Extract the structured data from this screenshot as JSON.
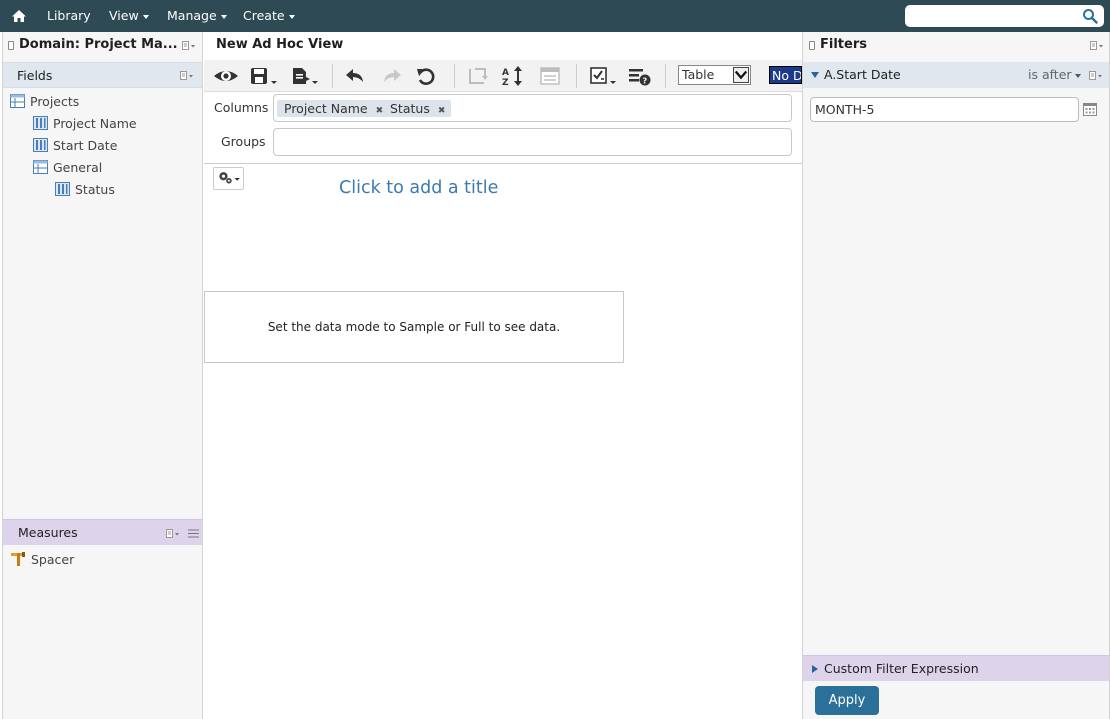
{
  "topbar": {
    "nav": [
      {
        "label": "Library",
        "has_caret": false
      },
      {
        "label": "View",
        "has_caret": true
      },
      {
        "label": "Manage",
        "has_caret": true
      },
      {
        "label": "Create",
        "has_caret": true
      }
    ],
    "search_value": ""
  },
  "left_panel": {
    "title": "Domain: Project Ma...",
    "fields_label": "Fields",
    "tree": [
      {
        "label": "Projects",
        "type": "table"
      },
      {
        "label": "Project Name",
        "type": "field"
      },
      {
        "label": "Start Date",
        "type": "field"
      },
      {
        "label": "General",
        "type": "table"
      },
      {
        "label": "Status",
        "type": "field"
      }
    ],
    "measures_label": "Measures",
    "measures": [
      {
        "label": "Spacer"
      }
    ]
  },
  "center": {
    "title": "New Ad Hoc View",
    "view_type": "Table",
    "data_mode": "No Data",
    "columns_label": "Columns",
    "columns": [
      "Project Name",
      "Status"
    ],
    "groups_label": "Groups",
    "add_title": "Click to add a title",
    "message": "Set the data mode to Sample or Full to see data."
  },
  "right_panel": {
    "title": "Filters",
    "filter_field": "A.Start Date",
    "filter_operator": "is after",
    "filter_value": "MONTH-5",
    "custom_expression_label": "Custom Filter Expression",
    "apply_label": "Apply"
  },
  "colors": {
    "topbar": "#2e4a55",
    "accent_blue": "#2b7099",
    "title_link": "#3c7ab0",
    "filter_header": "#e0e7ef",
    "measures_header": "#ddd4ec"
  }
}
